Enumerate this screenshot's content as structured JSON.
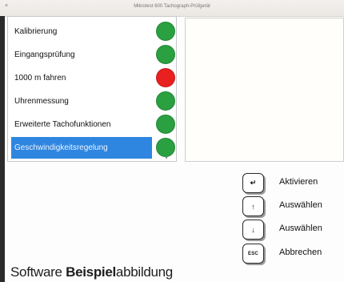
{
  "window": {
    "title": "Mikrotest 600 Tachograph-Prüfgerät"
  },
  "tests": [
    {
      "label": "Kalibrierung",
      "status": "ok",
      "color": "#2aa040"
    },
    {
      "label": "Eingangsprüfung",
      "status": "ok",
      "color": "#2aa040"
    },
    {
      "label": "1000 m fahren",
      "status": "error",
      "color": "#e82020"
    },
    {
      "label": "Uhrenmessung",
      "status": "ok",
      "color": "#2aa040"
    },
    {
      "label": "Erweiterte Tachofunktionen",
      "status": "ok",
      "color": "#2aa040"
    },
    {
      "label": "Geschwindigkeitsregelung",
      "status": "ok",
      "color": "#2aa040",
      "selected": true
    }
  ],
  "buttons": [
    {
      "key": "↵",
      "label": "Aktivieren"
    },
    {
      "key": "↑",
      "label": "Auswählen"
    },
    {
      "key": "↓",
      "label": "Auswählen"
    },
    {
      "key": "ESC",
      "label": "Abbrechen"
    }
  ],
  "caption": {
    "part1": "Software ",
    "part2": "Beispiel",
    "part3": "abbildung"
  },
  "colors": {
    "selection": "#2e86e0",
    "ok": "#2aa040",
    "error": "#e82020"
  }
}
